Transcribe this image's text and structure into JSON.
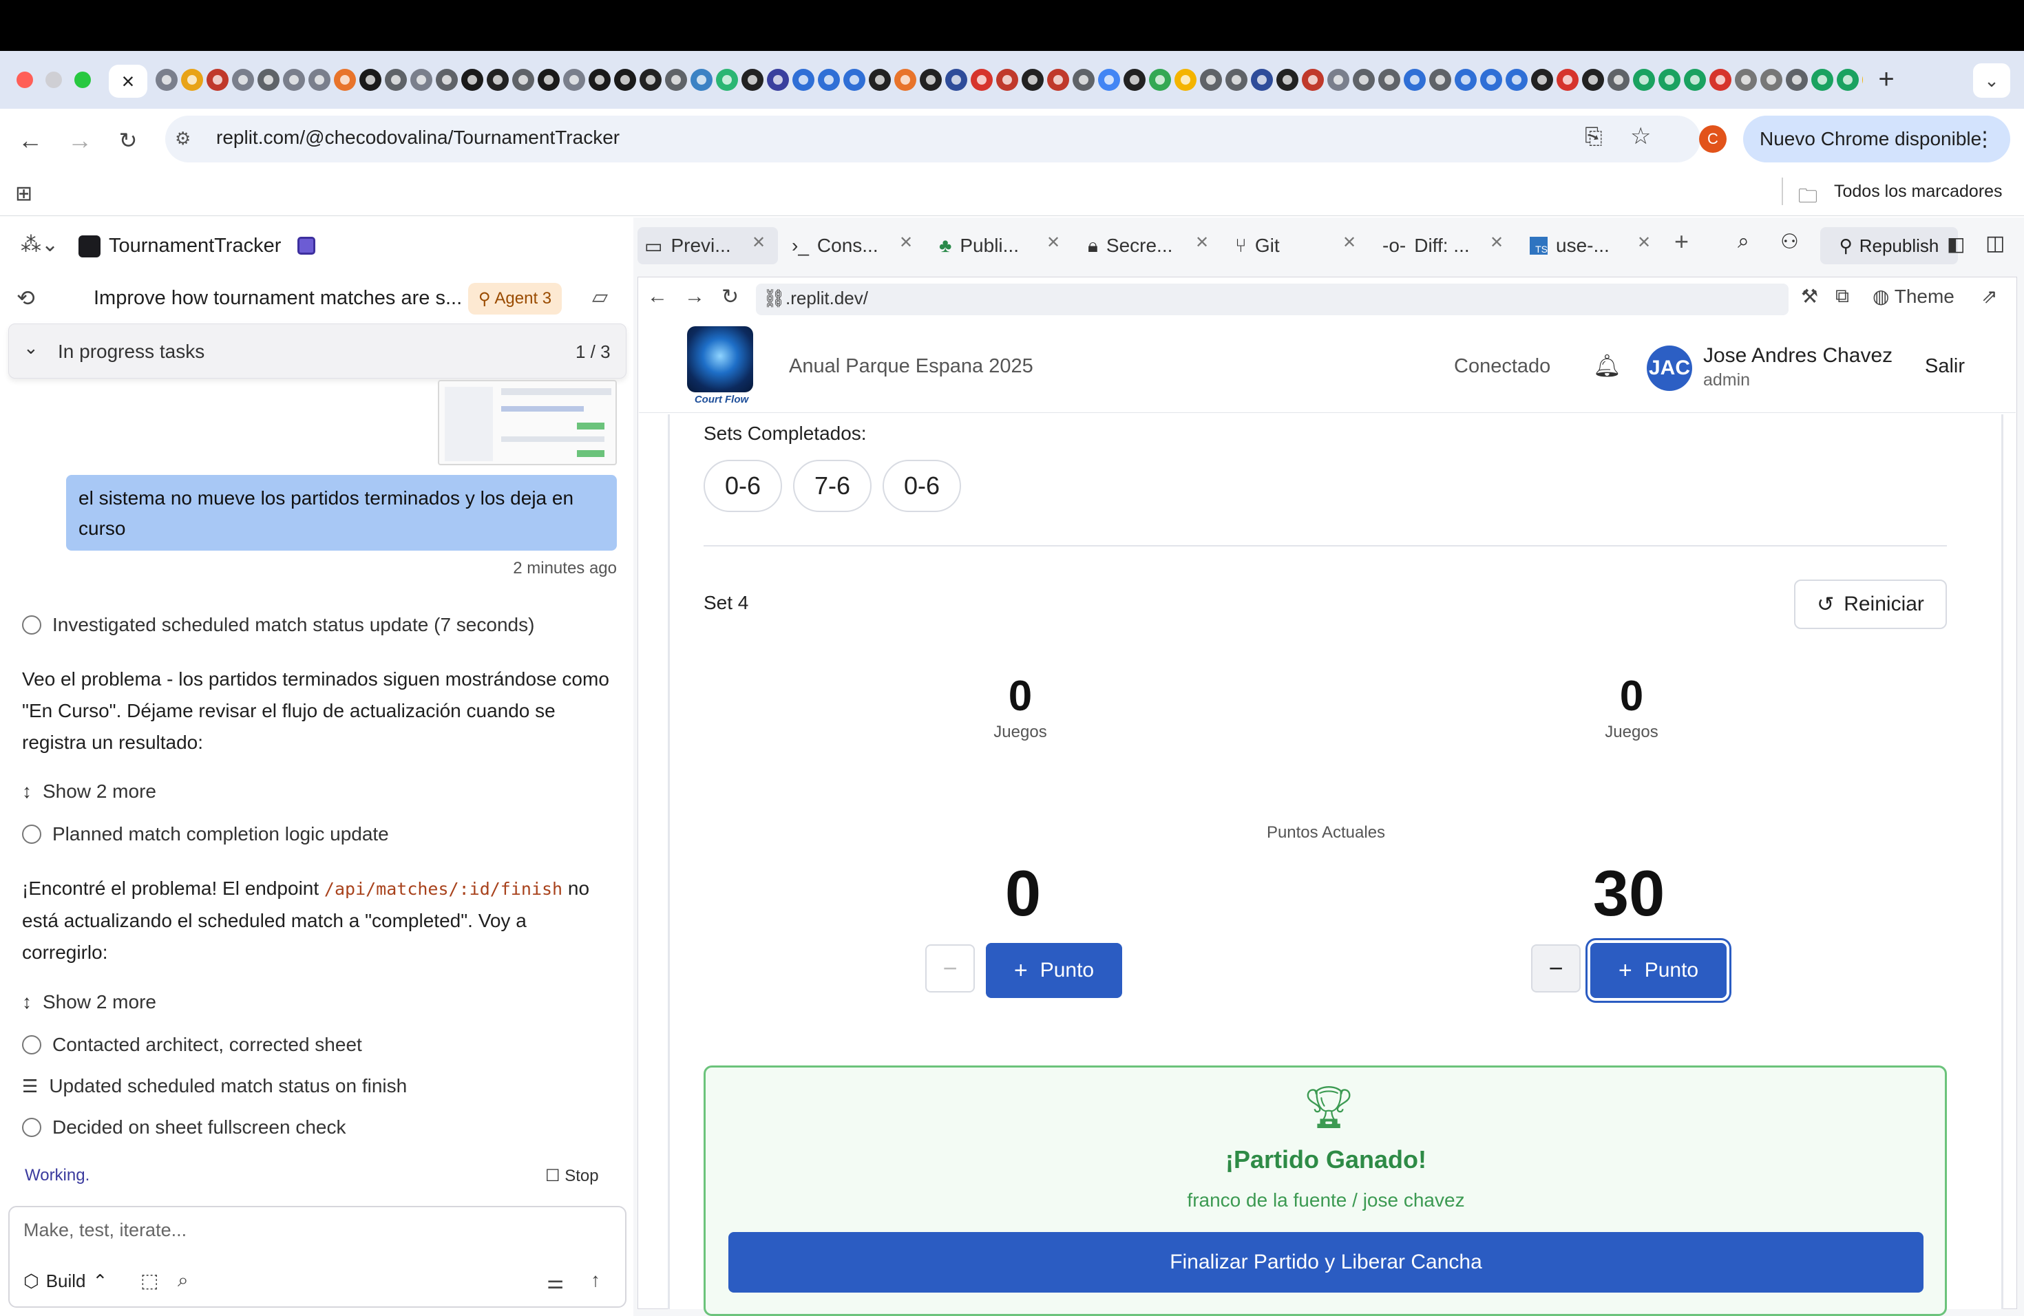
{
  "browser": {
    "tab_close": "×",
    "new_tab": "+",
    "url": "replit.com/@checodovalina/TournamentTracker",
    "chrome_update": "Nuevo Chrome disponible",
    "profile_initial": "C",
    "bookmarks_label": "Todos los marcadores"
  },
  "replit": {
    "project_name": "TournamentTracker",
    "thread_title": "Improve how tournament matches are s...",
    "agent_badge": "Agent 3",
    "progress_label": "In progress tasks",
    "progress_count": "1 / 3",
    "user_message": "el sistema no mueve los partidos terminados y los deja en curso",
    "user_message_time": "2 minutes ago",
    "step_investigated": "Investigated scheduled match status update (7 seconds)",
    "agent_msg1": "Veo el problema - los partidos terminados siguen mostrándose como \"En Curso\". Déjame revisar el flujo de actualización cuando se registra un resultado:",
    "show_more_1": "Show 2 more",
    "step_planned": "Planned match completion logic update",
    "agent_msg2_pre": "¡Encontré el problema! El endpoint ",
    "agent_msg2_code": "/api/matches/:id/finish",
    "agent_msg2_post": " no está actualizando el scheduled match a \"completed\". Voy a corregirlo:",
    "show_more_2": "Show 2 more",
    "step_contacted": "Contacted architect, corrected sheet",
    "step_updated": "Updated scheduled match status on finish",
    "step_decided": "Decided on sheet fullscreen check",
    "working": "Working.",
    "stop": "Stop",
    "input_placeholder": "Make, test, iterate...",
    "build_label": "Build"
  },
  "workspace_tabs": [
    {
      "label": "Previ..."
    },
    {
      "label": "Cons..."
    },
    {
      "label": "Publi..."
    },
    {
      "label": "Secre..."
    },
    {
      "label": "Git"
    },
    {
      "label": "Diff: ..."
    },
    {
      "label": "use-..."
    }
  ],
  "republish": "Republish",
  "preview": {
    "url": ".replit.dev/",
    "theme": "Theme"
  },
  "app": {
    "logo_caption": "Court Flow",
    "tournament": "Anual Parque Espana 2025",
    "status": "Conectado",
    "avatar_initials": "JAC",
    "user_name": "Jose Andres Chavez",
    "user_role": "admin",
    "logout": "Salir",
    "sets_label": "Sets Completados:",
    "sets": [
      "0-6",
      "7-6",
      "0-6"
    ],
    "current_set": "Set 4",
    "reset": "Reiniciar",
    "games_left": "0",
    "games_right": "0",
    "games_label": "Juegos",
    "points_label": "Puntos Actuales",
    "points_left": "0",
    "points_right": "30",
    "minus": "−",
    "punto_label": "Punto",
    "won_title": "¡Partido Ganado!",
    "winner": "franco de la fuente / jose chavez",
    "finish_button": "Finalizar Partido y Liberar Cancha"
  }
}
